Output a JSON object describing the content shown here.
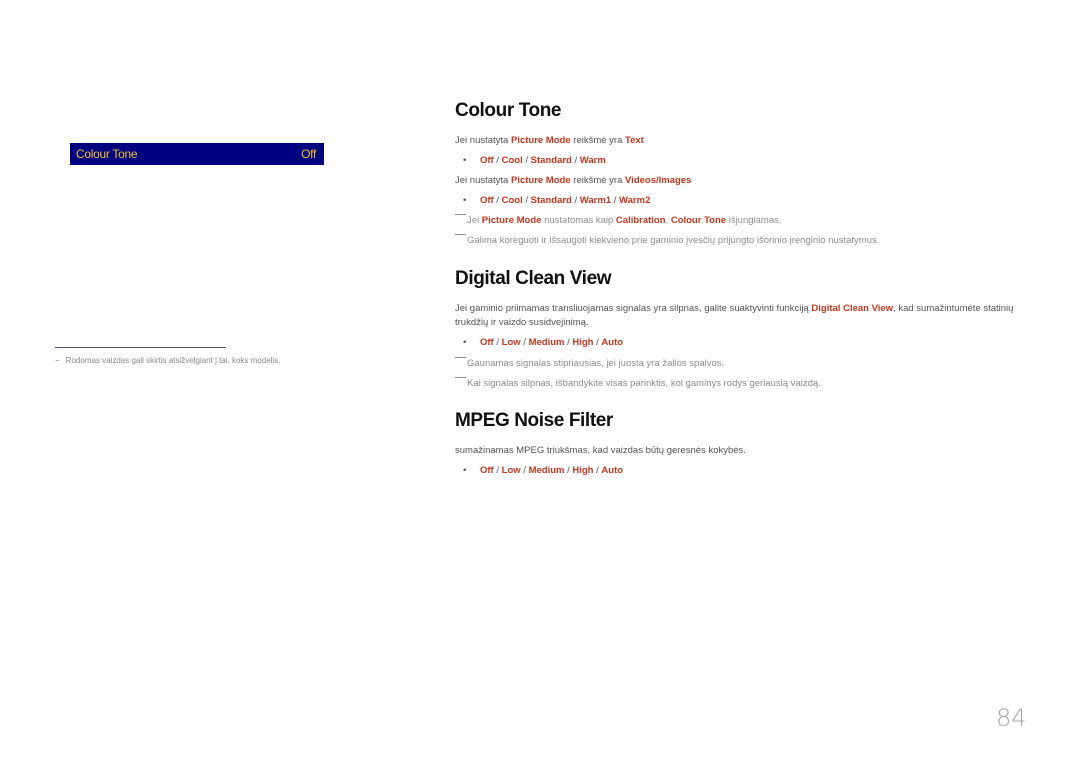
{
  "osd": {
    "label": "Colour Tone",
    "value": "Off",
    "colors": {
      "background": "#000080",
      "text": "#f2c230"
    }
  },
  "left_footnote": {
    "dash": "−",
    "text": "Rodomas vaizdas gali skirtis atsižvelgiant į tai, koks modelis."
  },
  "accent_color": "#c8361d",
  "sections": {
    "colour_tone": {
      "title": "Colour Tone",
      "line1": {
        "pre": "Jei nustatyta ",
        "mode": "Picture Mode",
        "mid": " reikšmė yra ",
        "value": "Text"
      },
      "options1": [
        "Off",
        "Cool",
        "Standard",
        "Warm"
      ],
      "line2": {
        "pre": "Jei nustatyta ",
        "mode": "Picture Mode",
        "mid": " reikšmė yra ",
        "value": "Videos/Images"
      },
      "options2": [
        "Off",
        "Cool",
        "Standard",
        "Warm1",
        "Warm2"
      ],
      "note1": {
        "pre": "Jei ",
        "mode": "Picture Mode",
        "mid": " nustatomas kaip ",
        "value": "Calibration",
        "sep": ", ",
        "feature": "Colour Tone",
        "post": " išjungiamas."
      },
      "note2": "Galima koreguoti ir išsaugoti kiekvieno prie gaminio įvesčių prijungto išorinio įrenginio nustatymus."
    },
    "digital_clean_view": {
      "title": "Digital Clean View",
      "para_pre": "Jei gaminio priimamas transliuojamas signalas yra silpnas, galite suaktyvinti funkciją ",
      "para_feature": "Digital Clean View",
      "para_post": ", kad sumažintumėte statinių trukdžių ir vaizdo susidvejinimą.",
      "options": [
        "Off",
        "Low",
        "Medium",
        "High",
        "Auto"
      ],
      "note1": "Gaunamas signalas stipriausias, jei juosta yra žalios spalvos.",
      "note2": "Kai signalas silpnas, išbandykite visas parinktis, kol gaminys rodys geriausią vaizdą."
    },
    "mpeg_noise_filter": {
      "title": "MPEG Noise Filter",
      "para": "sumažinamas MPEG triukšmas, kad vaizdas būtų geresnės kokybės.",
      "options": [
        "Off",
        "Low",
        "Medium",
        "High",
        "Auto"
      ]
    }
  },
  "bullet": "•",
  "separator": " / ",
  "page_number": "84"
}
